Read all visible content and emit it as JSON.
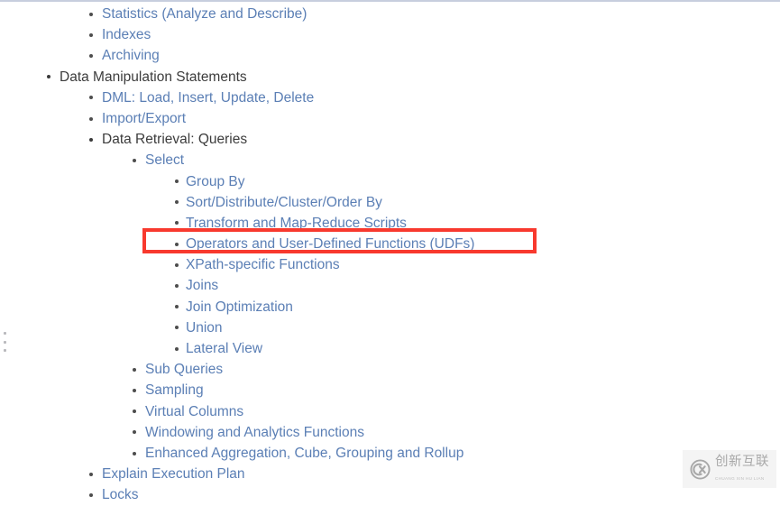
{
  "page": {
    "background_color": "#ffffff",
    "link_color": "#5b7fb5",
    "text_color": "#3c3c3c",
    "highlight_color": "#f8392e",
    "top_rule_color": "#c7cede"
  },
  "toc": {
    "items": [
      {
        "label": "Statistics (Analyze and Describe)",
        "level": 2,
        "kind": "link"
      },
      {
        "label": "Indexes",
        "level": 2,
        "kind": "link"
      },
      {
        "label": "Archiving",
        "level": 2,
        "kind": "link"
      },
      {
        "label": "Data Manipulation Statements",
        "level": 1,
        "kind": "plain"
      },
      {
        "label": "DML: Load, Insert, Update, Delete",
        "level": 2,
        "kind": "link"
      },
      {
        "label": "Import/Export",
        "level": 2,
        "kind": "link"
      },
      {
        "label": "Data Retrieval: Queries",
        "level": 2,
        "kind": "plain"
      },
      {
        "label": "Select",
        "level": 3,
        "kind": "link"
      },
      {
        "label": "Group By",
        "level": 4,
        "kind": "link"
      },
      {
        "label": "Sort/Distribute/Cluster/Order By",
        "level": 4,
        "kind": "link"
      },
      {
        "label": "Transform and Map-Reduce Scripts",
        "level": 4,
        "kind": "link"
      },
      {
        "label": "Operators and User-Defined Functions (UDFs)",
        "level": 4,
        "kind": "link",
        "highlighted": true
      },
      {
        "label": "XPath-specific Functions",
        "level": 4,
        "kind": "link"
      },
      {
        "label": "Joins",
        "level": 4,
        "kind": "link"
      },
      {
        "label": "Join Optimization",
        "level": 4,
        "kind": "link"
      },
      {
        "label": "Union",
        "level": 4,
        "kind": "link"
      },
      {
        "label": "Lateral View",
        "level": 4,
        "kind": "link"
      },
      {
        "label": "Sub Queries",
        "level": 3,
        "kind": "link"
      },
      {
        "label": "Sampling",
        "level": 3,
        "kind": "link"
      },
      {
        "label": "Virtual Columns",
        "level": 3,
        "kind": "link"
      },
      {
        "label": "Windowing and Analytics Functions",
        "level": 3,
        "kind": "link"
      },
      {
        "label": "Enhanced Aggregation, Cube, Grouping and Rollup",
        "level": 3,
        "kind": "link"
      },
      {
        "label": "Explain Execution Plan",
        "level": 2,
        "kind": "link"
      },
      {
        "label": "Locks",
        "level": 2,
        "kind": "link"
      }
    ]
  },
  "annotation": {
    "target_label": "Operators and User-Defined Functions (UDFs)",
    "shape": "rectangle",
    "color": "#f8392e"
  },
  "handle": {
    "icon": "drag-dots-icon",
    "dots": 3
  },
  "watermark": {
    "logo_icon": "circled-cx-logo-icon",
    "chinese": "创新互联",
    "pinyin": "CHUANG XIN HU LIAN"
  }
}
